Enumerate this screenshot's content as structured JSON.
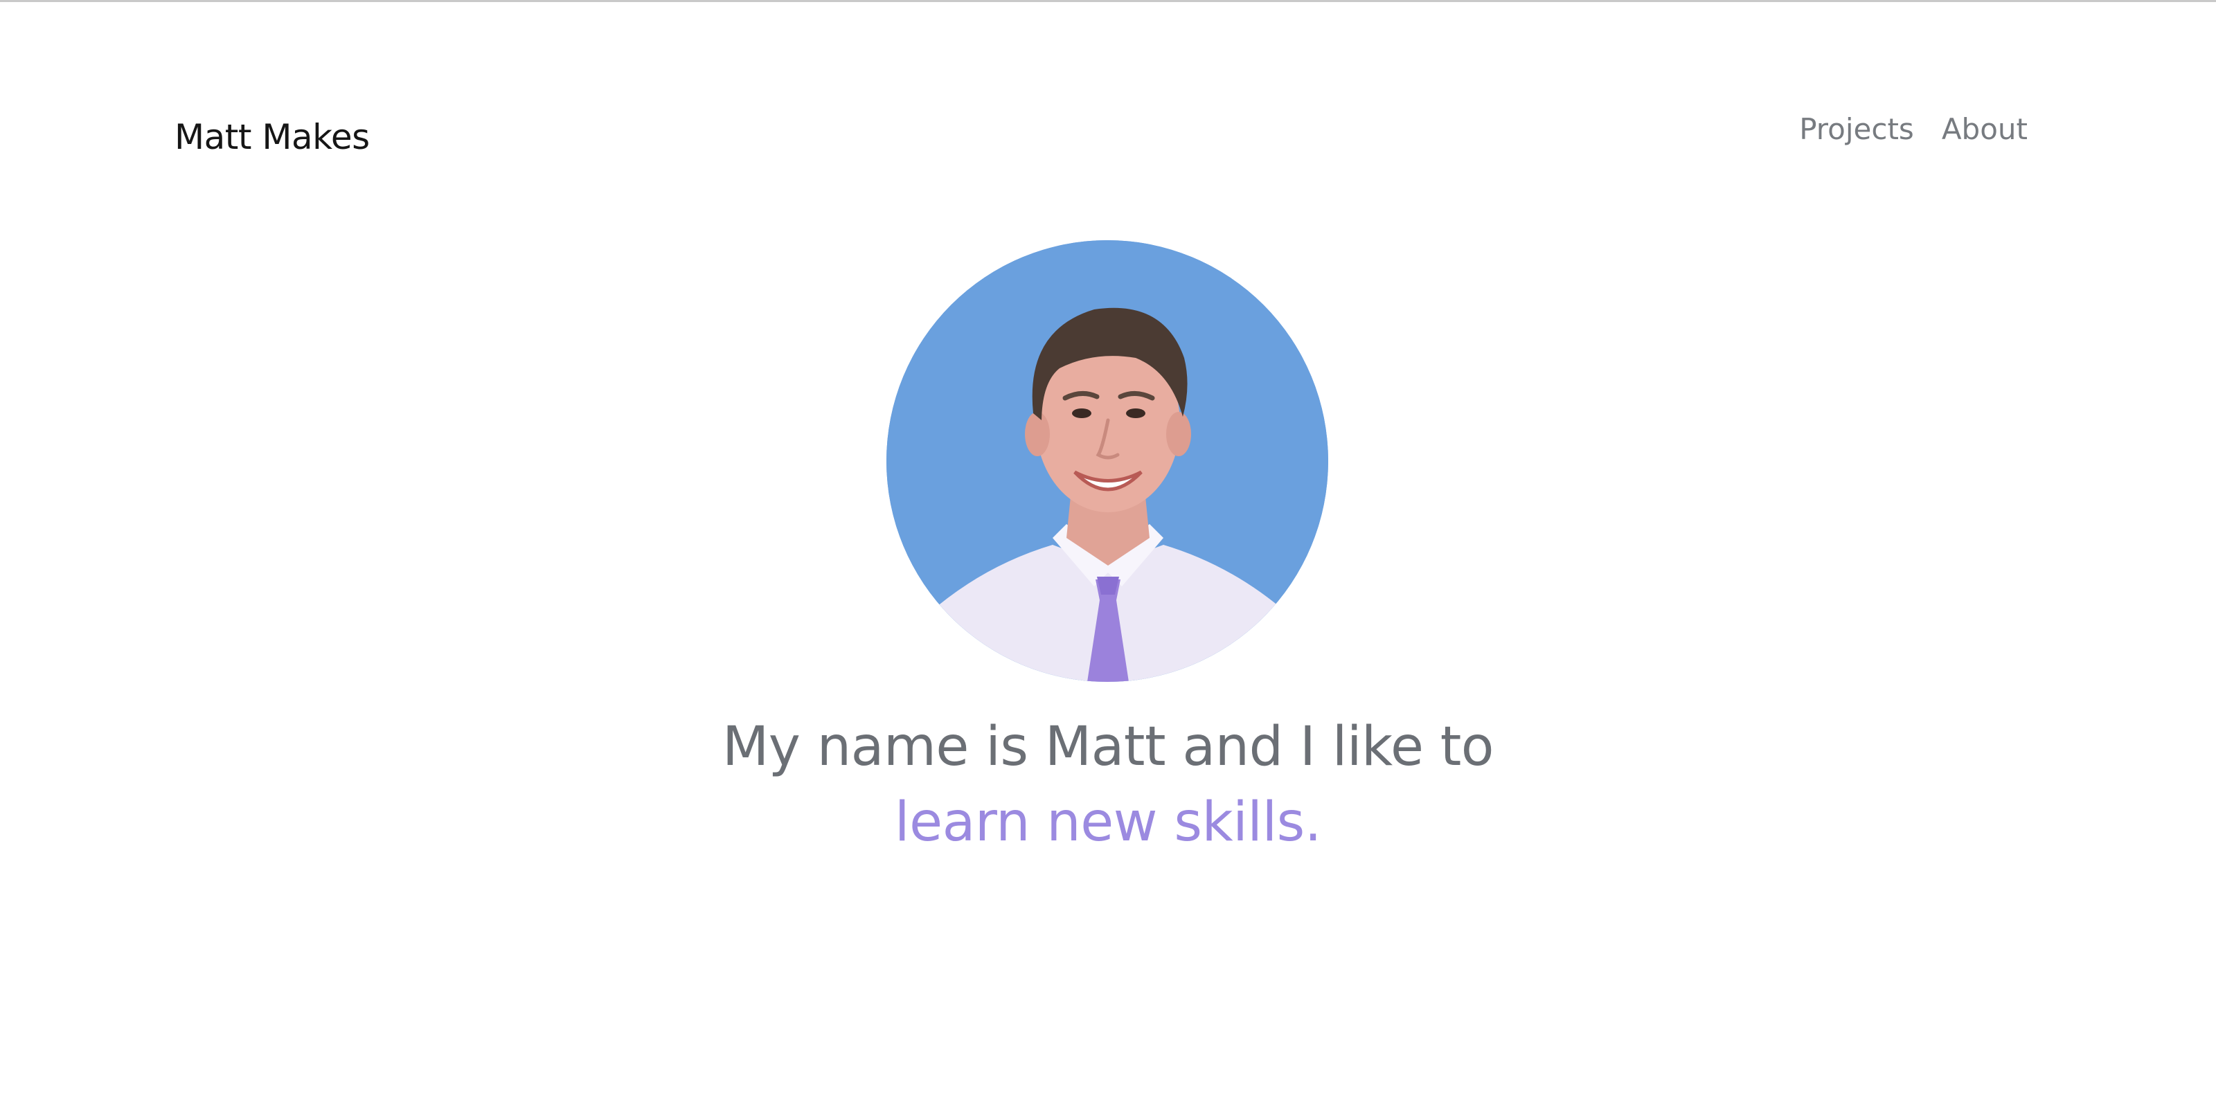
{
  "header": {
    "brand": "Matt Makes",
    "nav": [
      {
        "label": "Projects"
      },
      {
        "label": "About"
      }
    ]
  },
  "hero": {
    "avatar_alt": "Portrait photo of Matt",
    "line1": "My name is Matt and I like to",
    "line2": "learn new skills."
  },
  "colors": {
    "avatar_bg": "#6aa0de",
    "accent": "#9b8ae0",
    "text_muted": "#6b6f75",
    "brand_text": "#161616"
  }
}
